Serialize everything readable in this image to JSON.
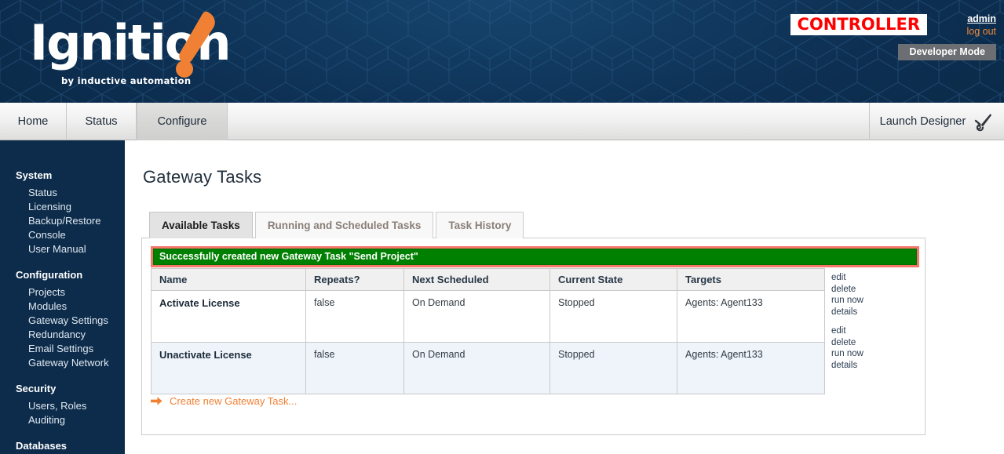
{
  "header": {
    "logo_word": "Ignition",
    "logo_tagline": "by inductive automation",
    "controller_badge": "CONTROLLER",
    "user_name": "admin",
    "log_out": "log out",
    "developer_mode": "Developer Mode",
    "controller_color": "#fe0000",
    "accent_color": "#f08134",
    "header_bg": "#0d2f52"
  },
  "nav": {
    "tabs": [
      {
        "label": "Home",
        "active": false
      },
      {
        "label": "Status",
        "active": false
      },
      {
        "label": "Configure",
        "active": true
      }
    ],
    "launch_designer": "Launch Designer",
    "launch_designer_icon": "wrench-icon"
  },
  "sidebar": {
    "groups": [
      {
        "title": "System",
        "items": [
          "Status",
          "Licensing",
          "Backup/Restore",
          "Console",
          "User Manual"
        ]
      },
      {
        "title": "Configuration",
        "items": [
          "Projects",
          "Modules",
          "Gateway Settings",
          "Redundancy",
          "Email Settings",
          "Gateway Network"
        ]
      },
      {
        "title": "Security",
        "items": [
          "Users, Roles",
          "Auditing"
        ]
      },
      {
        "title": "Databases",
        "items": []
      }
    ]
  },
  "main": {
    "page_title": "Gateway Tasks",
    "tabs": [
      {
        "label": "Available Tasks",
        "active": true
      },
      {
        "label": "Running and Scheduled Tasks",
        "active": false
      },
      {
        "label": "Task History",
        "active": false
      }
    ],
    "alert": {
      "message": "Successfully created new Gateway Task \"Send Project\"",
      "bg_color": "#008000",
      "border_color": "#f4776a",
      "text_color": "#ffffff"
    },
    "table": {
      "columns": [
        "Name",
        "Repeats?",
        "Next Scheduled",
        "Current State",
        "Targets"
      ],
      "rows": [
        {
          "name": "Activate License",
          "repeats": "false",
          "next_scheduled": "On Demand",
          "current_state": "Stopped",
          "targets": "Agents: Agent133"
        },
        {
          "name": "Unactivate License",
          "repeats": "false",
          "next_scheduled": "On Demand",
          "current_state": "Stopped",
          "targets": "Agents: Agent133"
        }
      ],
      "row_actions": [
        "edit",
        "delete",
        "run now",
        "details"
      ]
    },
    "create_link": {
      "label": "Create new Gateway Task...",
      "icon": "arrow-right-icon"
    }
  }
}
